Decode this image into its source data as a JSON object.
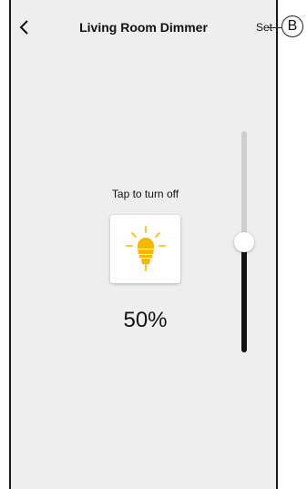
{
  "header": {
    "back_icon": "chevron-left-icon",
    "title": "Living Room Dimmer",
    "set_label": "Set",
    "callout_label": "B"
  },
  "main": {
    "tap_label": "Tap to turn off",
    "bulb_icon": "light-bulb-icon",
    "level_text": "50%",
    "slider_level": 0.5
  },
  "colors": {
    "bulb": "#f5b800",
    "background": "#eeeeee",
    "slider_fill": "#111111",
    "slider_track": "#cfcfcf"
  }
}
